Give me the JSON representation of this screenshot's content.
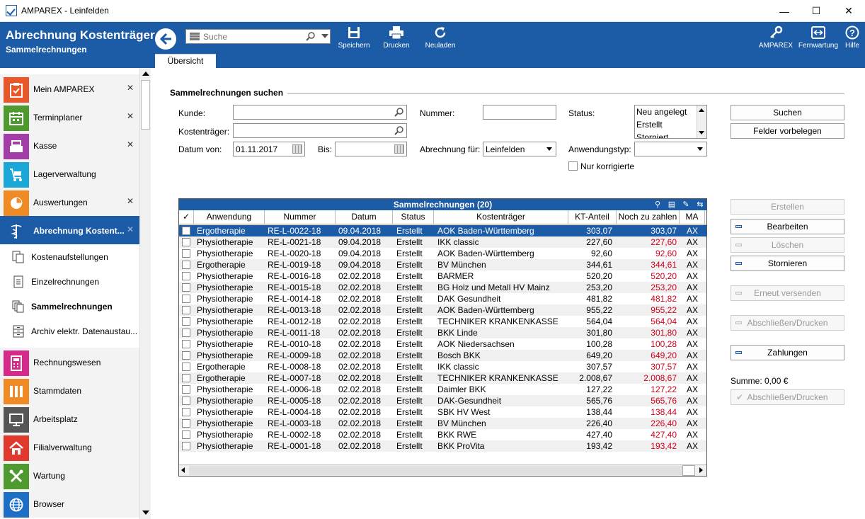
{
  "window": {
    "title": "AMPAREX - Leinfelden",
    "minimize": "—",
    "maximize": "☐",
    "close": "✕"
  },
  "header": {
    "title": "Abrechnung Kostenträger",
    "subtitle": "Sammelrechnungen",
    "search_placeholder": "Suche",
    "toolbar": {
      "save": "Speichern",
      "print": "Drucken",
      "reload": "Neuladen"
    },
    "right": {
      "amparex": "AMPAREX",
      "remote": "Fernwartung",
      "help": "Hilfe"
    },
    "tab": "Übersicht"
  },
  "sidebar": {
    "nav_top": [
      {
        "label": "Mein AMPAREX",
        "color": "#e8562a",
        "icon": "clipboard-icon",
        "closable": true
      },
      {
        "label": "Terminplaner",
        "color": "#4e9a2f",
        "icon": "calendar-icon",
        "closable": true
      },
      {
        "label": "Kasse",
        "color": "#a33ea8",
        "icon": "cash-register-icon",
        "closable": true
      },
      {
        "label": "Lagerverwaltung",
        "color": "#1aa6d6",
        "icon": "cart-icon",
        "closable": false
      },
      {
        "label": "Auswertungen",
        "color": "#f08a24",
        "icon": "pie-chart-icon",
        "closable": true
      },
      {
        "label": "Abrechnung Kostent...",
        "color": "#1c5ba5",
        "icon": "caduceus-icon",
        "closable": true
      }
    ],
    "subitems": [
      {
        "label": "Kostenaufstellungen",
        "icon": "documents-icon"
      },
      {
        "label": "Einzelrechnungen",
        "icon": "document-icon"
      },
      {
        "label": "Sammelrechnungen",
        "icon": "stacked-documents-icon",
        "selected": true
      },
      {
        "label": "Archiv elektr. Datenaustau...",
        "icon": "archive-icon"
      }
    ],
    "nav_bottom": [
      {
        "label": "Rechnungswesen",
        "color": "#d6298a",
        "icon": "calculator-icon"
      },
      {
        "label": "Stammdaten",
        "color": "#f08a24",
        "icon": "columns-icon"
      },
      {
        "label": "Arbeitsplatz",
        "color": "#555555",
        "icon": "monitor-icon"
      },
      {
        "label": "Filialverwaltung",
        "color": "#e03a2f",
        "icon": "house-icon"
      },
      {
        "label": "Wartung",
        "color": "#4e9a2f",
        "icon": "tools-icon"
      },
      {
        "label": "Browser",
        "color": "#1c6fc4",
        "icon": "globe-icon"
      }
    ]
  },
  "form": {
    "section_title": "Sammelrechnungen suchen",
    "kunde_label": "Kunde:",
    "kunde_value": "",
    "kostentraeger_label": "Kostenträger:",
    "kostentraeger_value": "",
    "datum_von_label": "Datum von:",
    "datum_von_value": "01.11.2017",
    "bis_label": "Bis:",
    "bis_value": "",
    "nummer_label": "Nummer:",
    "nummer_value": "",
    "abrechnung_label": "Abrechnung für:",
    "abrechnung_value": "Leinfelden",
    "status_label": "Status:",
    "status_options": [
      "Neu angelegt",
      "Erstellt",
      "Storniert"
    ],
    "anwendungstyp_label": "Anwendungstyp:",
    "anwendungstyp_value": "",
    "nur_korrigierte_label": "Nur korrigierte",
    "suchen_button": "Suchen",
    "felder_button": "Felder vorbelegen"
  },
  "table": {
    "caption": "Sammelrechnungen (20)",
    "columns": [
      "Anwendung",
      "Nummer",
      "Datum",
      "Status",
      "Kostenträger",
      "KT-Anteil",
      "Noch zu zahlen",
      "MA"
    ],
    "rows": [
      [
        "Ergotherapie",
        "RE-L-0022-18",
        "09.04.2018",
        "Erstellt",
        "AOK Baden-Württemberg",
        "303,07",
        "303,07",
        "AX"
      ],
      [
        "Physiotherapie",
        "RE-L-0021-18",
        "09.04.2018",
        "Erstellt",
        "IKK classic",
        "227,60",
        "227,60",
        "AX"
      ],
      [
        "Physiotherapie",
        "RE-L-0020-18",
        "09.04.2018",
        "Erstellt",
        "AOK Baden-Württemberg",
        "92,60",
        "92,60",
        "AX"
      ],
      [
        "Ergotherapie",
        "RE-L-0019-18",
        "09.04.2018",
        "Erstellt",
        "BV München",
        "344,61",
        "344,61",
        "AX"
      ],
      [
        "Physiotherapie",
        "RE-L-0016-18",
        "02.02.2018",
        "Erstellt",
        "BARMER",
        "520,20",
        "520,20",
        "AX"
      ],
      [
        "Physiotherapie",
        "RE-L-0015-18",
        "02.02.2018",
        "Erstellt",
        "BG Holz und Metall HV Mainz",
        "253,20",
        "253,20",
        "AX"
      ],
      [
        "Physiotherapie",
        "RE-L-0014-18",
        "02.02.2018",
        "Erstellt",
        "DAK Gesundheit",
        "481,82",
        "481,82",
        "AX"
      ],
      [
        "Physiotherapie",
        "RE-L-0013-18",
        "02.02.2018",
        "Erstellt",
        "AOK Baden-Württemberg",
        "955,22",
        "955,22",
        "AX"
      ],
      [
        "Physiotherapie",
        "RE-L-0012-18",
        "02.02.2018",
        "Erstellt",
        "TECHNIKER KRANKENKASSE",
        "564,04",
        "564,04",
        "AX"
      ],
      [
        "Physiotherapie",
        "RE-L-0011-18",
        "02.02.2018",
        "Erstellt",
        "BKK Linde",
        "301,80",
        "301,80",
        "AX"
      ],
      [
        "Physiotherapie",
        "RE-L-0010-18",
        "02.02.2018",
        "Erstellt",
        "AOK Niedersachsen",
        "100,28",
        "100,28",
        "AX"
      ],
      [
        "Physiotherapie",
        "RE-L-0009-18",
        "02.02.2018",
        "Erstellt",
        "Bosch BKK",
        "649,20",
        "649,20",
        "AX"
      ],
      [
        "Ergotherapie",
        "RE-L-0008-18",
        "02.02.2018",
        "Erstellt",
        "IKK classic",
        "307,57",
        "307,57",
        "AX"
      ],
      [
        "Ergotherapie",
        "RE-L-0007-18",
        "02.02.2018",
        "Erstellt",
        "TECHNIKER KRANKENKASSE",
        "2.008,67",
        "2.008,67",
        "AX"
      ],
      [
        "Physiotherapie",
        "RE-L-0006-18",
        "02.02.2018",
        "Erstellt",
        "Daimler BKK",
        "127,22",
        "127,22",
        "AX"
      ],
      [
        "Physiotherapie",
        "RE-L-0005-18",
        "02.02.2018",
        "Erstellt",
        "DAK-Gesundheit",
        "565,76",
        "565,76",
        "AX"
      ],
      [
        "Physiotherapie",
        "RE-L-0004-18",
        "02.02.2018",
        "Erstellt",
        "SBK HV West",
        "138,44",
        "138,44",
        "AX"
      ],
      [
        "Physiotherapie",
        "RE-L-0003-18",
        "02.02.2018",
        "Erstellt",
        "BV München",
        "226,40",
        "226,40",
        "AX"
      ],
      [
        "Physiotherapie",
        "RE-L-0002-18",
        "02.02.2018",
        "Erstellt",
        "BKK RWE",
        "427,40",
        "427,40",
        "AX"
      ],
      [
        "Physiotherapie",
        "RE-L-0001-18",
        "02.02.2018",
        "Erstellt",
        "BKK ProVita",
        "193,42",
        "193,42",
        "AX"
      ]
    ]
  },
  "actions": {
    "erstellen": "Erstellen",
    "bearbeiten": "Bearbeiten",
    "loeschen": "Löschen",
    "stornieren": "Stornieren",
    "erneut_versenden": "Erneut versenden",
    "abschliessen_drucken": "Abschließen/Drucken",
    "zahlungen": "Zahlungen",
    "summe": "Summe: 0,00 €",
    "abschliessen_drucken2": "Abschließen/Drucken"
  },
  "colors": {
    "accent": "#1c5ba5",
    "amount_open": "#d0021b"
  }
}
